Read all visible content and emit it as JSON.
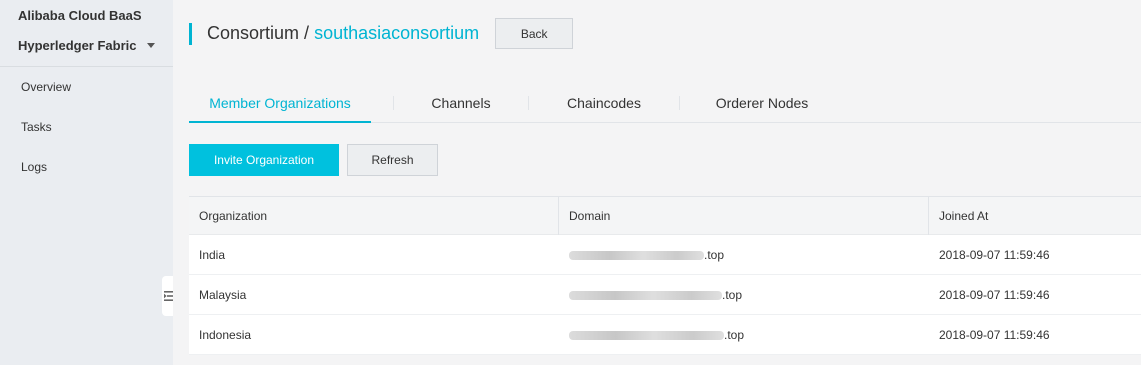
{
  "sidebar": {
    "title": "Alibaba Cloud BaaS",
    "subtitle": "Hyperledger Fabric",
    "items": [
      {
        "label": "Overview"
      },
      {
        "label": "Tasks"
      },
      {
        "label": "Logs"
      }
    ]
  },
  "header": {
    "crumb_root": "Consortium /",
    "crumb_current": "southasiaconsortium",
    "back_label": "Back"
  },
  "tabs": [
    {
      "label": "Member Organizations"
    },
    {
      "label": "Channels"
    },
    {
      "label": "Chaincodes"
    },
    {
      "label": "Orderer Nodes"
    }
  ],
  "actions": {
    "invite_label": "Invite Organization",
    "refresh_label": "Refresh"
  },
  "table": {
    "columns": [
      "Organization",
      "Domain",
      "Joined At"
    ],
    "rows": [
      {
        "organization": "India",
        "domain_suffix": ".top",
        "joined_at": "2018-09-07 11:59:46"
      },
      {
        "organization": "Malaysia",
        "domain_suffix": ".top",
        "joined_at": "2018-09-07 11:59:46"
      },
      {
        "organization": "Indonesia",
        "domain_suffix": ".top",
        "joined_at": "2018-09-07 11:59:46"
      }
    ]
  },
  "colors": {
    "accent": "#00b4d2",
    "primary_button": "#00c1de"
  }
}
